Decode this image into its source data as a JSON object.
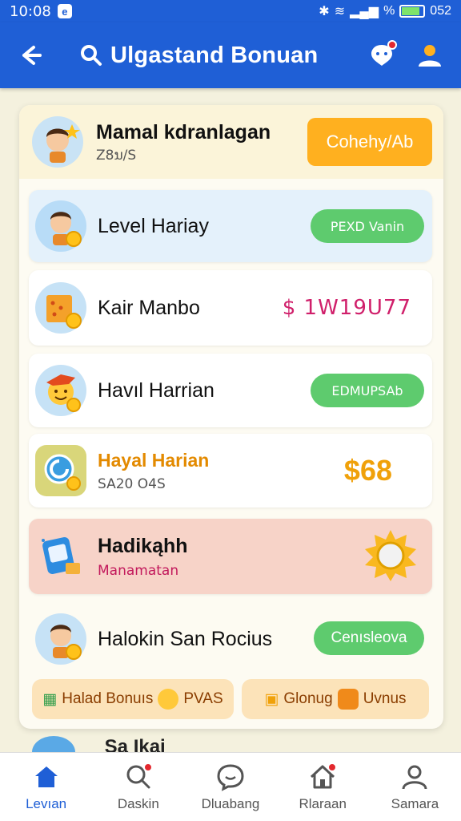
{
  "status_bar": {
    "time": "10:08",
    "battery": "052",
    "signal_text": "%"
  },
  "app_bar": {
    "title": "Ulgastand Bonuan"
  },
  "profile": {
    "name": "Mamal kdranlagan",
    "sub": "Z8ນ/S",
    "button": "Cohehy/Ab"
  },
  "rows": [
    {
      "label": "Level Hariay",
      "action": "PEXD Vanin",
      "action_type": "green"
    },
    {
      "label": "Kair Manbo",
      "value": "$ 1W19U77",
      "action_type": "pink"
    },
    {
      "label": "Havıl Harrian",
      "action": "EDMUPSAb",
      "action_type": "green"
    },
    {
      "label": "Hayal Harian",
      "sub": "SA20 O4S",
      "value": "$68",
      "action_type": "gold"
    },
    {
      "label": "Hadikąhh",
      "sub": "Manamatan",
      "action_type": "badge"
    },
    {
      "label": "Halokin San Rocius",
      "action": "Cenısleova",
      "action_type": "green"
    }
  ],
  "bonus_chips": [
    {
      "left": "Halad Bonuıs",
      "right": "PVAS"
    },
    {
      "left": "Glonug",
      "right": "Uvnus"
    }
  ],
  "peek_text": "Sa Ikai",
  "nav": [
    {
      "label": "Levıan",
      "icon": "home-icon",
      "active": true
    },
    {
      "label": "Daskin",
      "icon": "search-icon"
    },
    {
      "label": "Dluabang",
      "icon": "chat-icon"
    },
    {
      "label": "Rlaraan",
      "icon": "house-icon"
    },
    {
      "label": "Samara",
      "icon": "profile-icon"
    }
  ],
  "colors": {
    "primary": "#1f5fd6",
    "orange": "#ffb01f",
    "green": "#5ecb6e",
    "pink": "#d0206b",
    "gold": "#f0a10a",
    "highlight": "#f7d3c8"
  }
}
